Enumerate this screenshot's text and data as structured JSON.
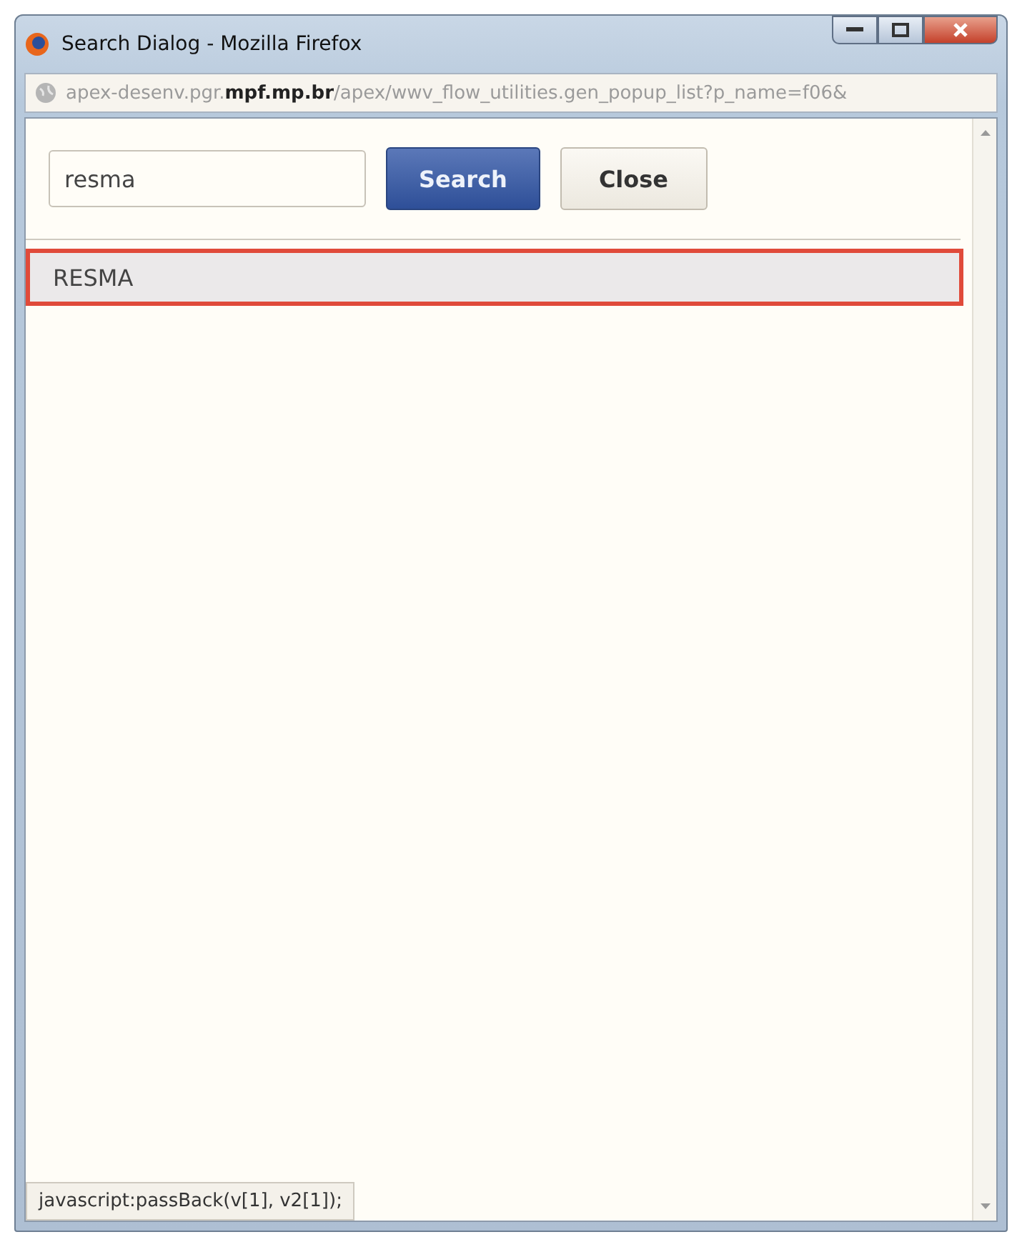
{
  "window": {
    "title": "Search Dialog - Mozilla Firefox"
  },
  "address_bar": {
    "url": "apex-desenv.pgr.**mpf.mp.br**/apex/wwv_flow_utilities.gen_popup_list?p_name=f06&"
  },
  "search": {
    "value": "resma"
  },
  "buttons": [
    {
      "label": "Search",
      "kind": "primary"
    },
    {
      "label": "Close",
      "kind": "secondary"
    }
  ],
  "results": [
    {
      "label": "RESMA",
      "selected": true
    }
  ],
  "status_bar": {
    "text": "javascript:passBack(v[1], v2[1]);"
  }
}
